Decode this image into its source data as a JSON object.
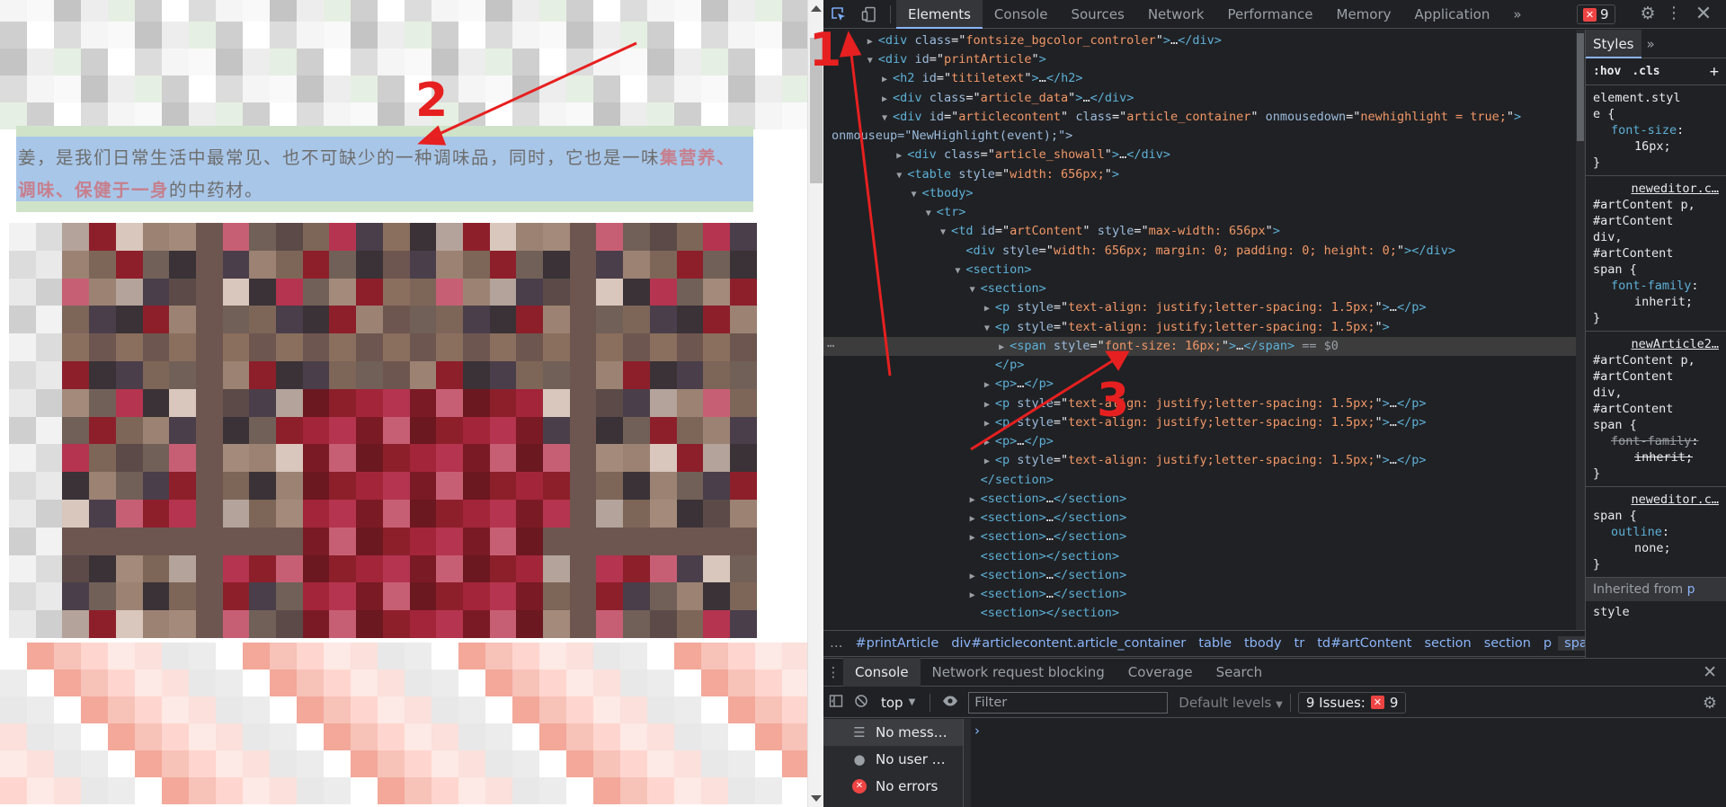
{
  "page": {
    "highlight_text_before": "姜，是我们日常生活中最常见、也不可缺少的一种调味品，同时，它也是一味",
    "highlight_text_bold": "集营养、调味、保健于一身",
    "highlight_text_after": "的中药材。"
  },
  "devtools": {
    "tabs": [
      "Elements",
      "Console",
      "Sources",
      "Network",
      "Performance",
      "Memory",
      "Application"
    ],
    "active_tab": "Elements",
    "more_tabs": "»",
    "error_count": "9",
    "dom_tree": [
      {
        "tag": "div",
        "attrs": [
          [
            "class",
            "fontsize_bgcolor_controler"
          ]
        ],
        "collapsed": true
      },
      {
        "tag": "div",
        "attrs": [
          [
            "id",
            "printArticle"
          ]
        ],
        "collapsed": false
      },
      {
        "tag": "h2",
        "attrs": [
          [
            "id",
            "titiletext"
          ]
        ],
        "collapsed": true
      },
      {
        "tag": "div",
        "attrs": [
          [
            "class",
            "article_data"
          ]
        ],
        "collapsed": true
      },
      {
        "tag": "div",
        "attrs": [
          [
            "id",
            "articlecontent"
          ],
          [
            "class",
            "article_container"
          ],
          [
            "onmousedown",
            "newhighlight = true;"
          ]
        ],
        "collapsed": false
      },
      {
        "cont": "onmouseup=\"NewHighlight(event);\">"
      },
      {
        "tag": "div",
        "attrs": [
          [
            "class",
            "article_showall"
          ]
        ],
        "collapsed": true
      },
      {
        "tag": "table",
        "attrs": [
          [
            "style",
            "width: 656px;"
          ]
        ],
        "collapsed": false
      },
      {
        "tag": "tbody",
        "attrs": [],
        "collapsed": false
      },
      {
        "tag": "tr",
        "attrs": [],
        "collapsed": false
      },
      {
        "tag": "td",
        "attrs": [
          [
            "id",
            "artContent"
          ],
          [
            "style",
            "max-width: 656px"
          ]
        ],
        "collapsed": false
      },
      {
        "tag": "div",
        "attrs": [
          [
            "style",
            "width: 656px; margin: 0; padding: 0; height: 0;"
          ]
        ],
        "empty": true
      },
      {
        "tag": "section",
        "attrs": [],
        "collapsed": false
      },
      {
        "tag": "section",
        "attrs": [],
        "collapsed": false
      },
      {
        "tag": "p",
        "attrs": [
          [
            "style",
            "text-align: justify;letter-spacing: 1.5px;"
          ]
        ],
        "collapsed": true
      },
      {
        "tag": "p",
        "attrs": [
          [
            "style",
            "text-align: justify;letter-spacing: 1.5px;"
          ]
        ],
        "collapsed": false
      },
      {
        "tag": "span",
        "attrs": [
          [
            "style",
            "font-size: 16px;"
          ]
        ],
        "collapsed": true,
        "selected": true,
        "suffix": " == $0"
      },
      {
        "close": "p"
      },
      {
        "tag": "p",
        "attrs": [],
        "collapsed": true
      },
      {
        "tag": "p",
        "attrs": [
          [
            "style",
            "text-align: justify;letter-spacing: 1.5px;"
          ]
        ],
        "collapsed": true
      },
      {
        "tag": "p",
        "attrs": [
          [
            "style",
            "text-align: justify;letter-spacing: 1.5px;"
          ]
        ],
        "collapsed": true
      },
      {
        "tag": "p",
        "attrs": [],
        "collapsed": true
      },
      {
        "tag": "p",
        "attrs": [
          [
            "style",
            "text-align: justify;letter-spacing: 1.5px;"
          ]
        ],
        "collapsed": true
      },
      {
        "close": "section"
      },
      {
        "tag": "section",
        "attrs": [],
        "collapsed": true
      },
      {
        "tag": "section",
        "attrs": [],
        "collapsed": true
      },
      {
        "tag": "section",
        "attrs": [],
        "collapsed": true
      },
      {
        "tag": "section",
        "attrs": [],
        "empty": true
      },
      {
        "tag": "section",
        "attrs": [],
        "collapsed": true
      },
      {
        "tag": "section",
        "attrs": [],
        "collapsed": true
      },
      {
        "tag": "section",
        "attrs": [],
        "empty": true
      }
    ],
    "styles": {
      "tab": "Styles",
      "more": "»",
      "hov": ":hov",
      "cls": ".cls",
      "plus": "+",
      "rules": [
        {
          "source": "",
          "selector": [
            "element.styl",
            "e {"
          ],
          "props": [
            [
              "font-size",
              "16px;",
              false
            ]
          ]
        },
        {
          "source": "neweditor.c…",
          "selector": [
            "#artContent p,",
            "#artContent",
            "div,",
            "#artContent",
            "span {"
          ],
          "props": [
            [
              "font-family",
              "inherit;",
              false
            ]
          ]
        },
        {
          "source": "newArticle2…",
          "selector": [
            "#artContent p,",
            "#artContent",
            "div,",
            "#artContent",
            "span {"
          ],
          "props": [
            [
              "font-family",
              "inherit;",
              true
            ]
          ]
        },
        {
          "source": "neweditor.c…",
          "selector": [
            "span {"
          ],
          "props": [
            [
              "outline",
              "none;",
              false
            ]
          ]
        }
      ],
      "inherited_label": "Inherited from",
      "inherited_el": "p",
      "last_line": "style"
    },
    "breadcrumbs": [
      "…",
      "#printArticle",
      "div#articlecontent.article_container",
      "table",
      "tbody",
      "tr",
      "td#artContent",
      "section",
      "section",
      "p",
      "span",
      "…"
    ],
    "drawer_tabs": [
      "Console",
      "Network request blocking",
      "Coverage",
      "Search"
    ],
    "console": {
      "context": "top",
      "filter_placeholder": "Filter",
      "levels": "Default levels",
      "issues_label": "9 Issues:",
      "issues_count": "9",
      "sidebar": [
        "No mess…",
        "No user …",
        "No errors"
      ],
      "prompt": "›"
    }
  },
  "annotations": {
    "labels": [
      "1",
      "2",
      "3"
    ],
    "color": "#e62020"
  }
}
